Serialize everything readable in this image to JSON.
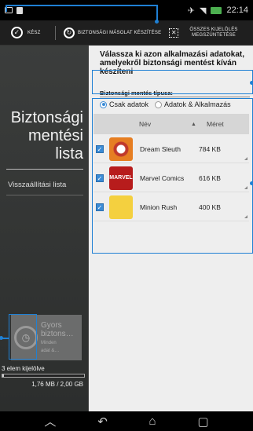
{
  "status_bar": {
    "time": "22:14",
    "icons": [
      "screenshot-icon",
      "sd-card-icon",
      "no-sim-icon",
      "wifi-icon",
      "battery-icon"
    ]
  },
  "action_bar": {
    "done_label": "KÉSZ",
    "backup_label": "BIZTONSÁGI MÁSOLAT KÉSZÍTÉSE",
    "deselect_line1": "ÖSSZES KIJELÖLÉS",
    "deselect_line2": "MEGSZÜNTETÉSE"
  },
  "left_pane": {
    "title_line1": "Biztonsági",
    "title_line2": "mentési",
    "title_line3": "lista",
    "restore_list": "Visszaállítási lista",
    "schedule_title_line1": "Gyors",
    "schedule_title_line2": "biztons…",
    "schedule_sub_line1": "Minden",
    "schedule_sub_line2": "adat &…",
    "selected_count": "3 elem kijelölve",
    "storage_text": "1,76 MB / 2,00 GB",
    "storage_fraction": 0.0009
  },
  "right_pane": {
    "heading": "Válassza ki azon alkalmazási adatokat, amelyekről biztonsági mentést kíván készíteni",
    "backup_type_label": "Biztonsági mentés típusa:",
    "radio_data_only": "Csak adatok",
    "radio_data_and_apps": "Adatok & Alkalmazás",
    "selected_radio": "Csak adatok",
    "columns": {
      "name": "Név",
      "size": "Méret"
    },
    "apps": [
      {
        "name": "Dream Sleuth",
        "size": "784 KB",
        "checked": true,
        "icon": "dream-sleuth-icon"
      },
      {
        "name": "Marvel Comics",
        "size": "616 KB",
        "checked": true,
        "icon": "marvel-comics-icon"
      },
      {
        "name": "Minion Rush",
        "size": "400 KB",
        "checked": true,
        "icon": "minion-rush-icon"
      }
    ]
  },
  "nav_bar": {
    "icons": [
      "recent-apps-up-icon",
      "back-icon",
      "home-icon",
      "recent-apps-icon"
    ]
  },
  "colors": {
    "accent": "#3a8bd6",
    "annotation": "#1f80d4",
    "left_pane_bg": "#3b3d3c",
    "right_pane_bg": "#eeeeee"
  }
}
